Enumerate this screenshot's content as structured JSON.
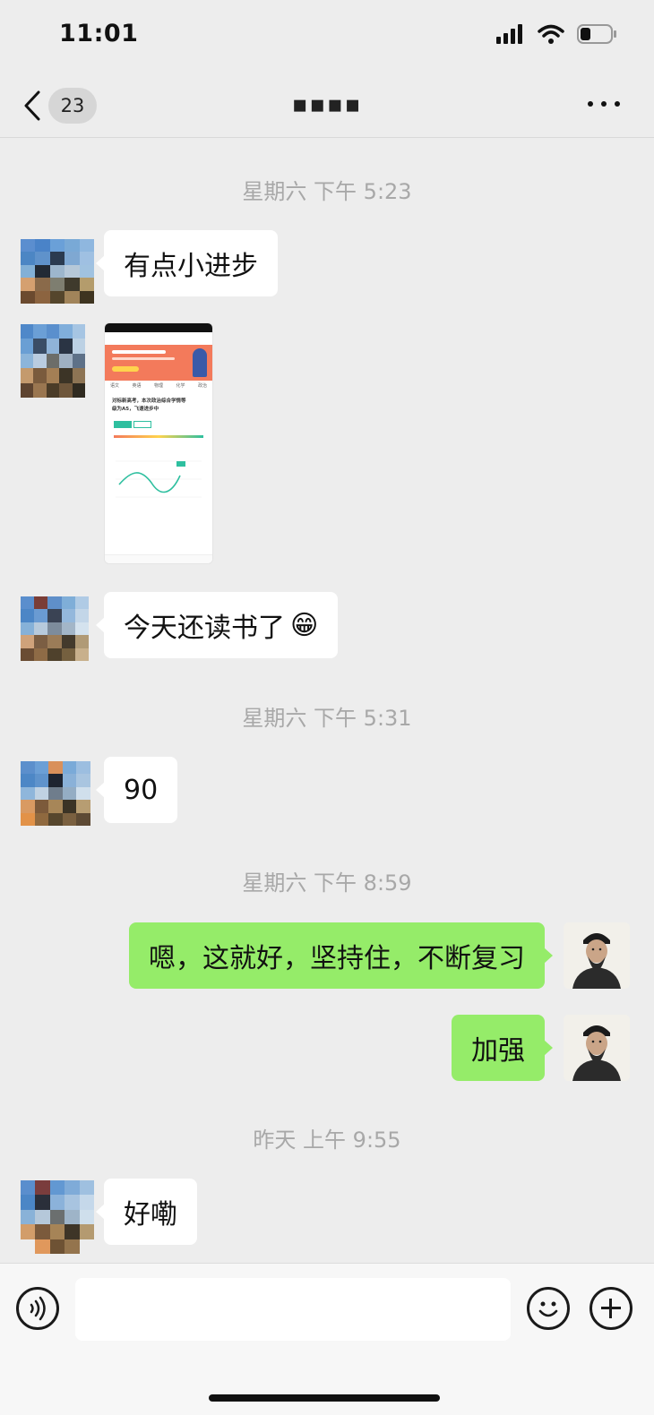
{
  "status_bar": {
    "time": "11:01"
  },
  "nav": {
    "unread_count": "23",
    "title": "▪▪▪▪"
  },
  "messages": [
    {
      "type": "timestamp",
      "text": "星期六 下午 5:23"
    },
    {
      "type": "text",
      "side": "in",
      "text": "有点小进步"
    },
    {
      "type": "image",
      "side": "in",
      "caption_lines": [
        "对标新高考，本次政治综合学情等",
        "级为A5，飞速进步中"
      ]
    },
    {
      "type": "text",
      "side": "in",
      "text": "今天还读书了",
      "emoji": "😁"
    },
    {
      "type": "timestamp",
      "text": "星期六 下午 5:31"
    },
    {
      "type": "text",
      "side": "in",
      "text": "90"
    },
    {
      "type": "timestamp",
      "text": "星期六 下午 8:59"
    },
    {
      "type": "text",
      "side": "out",
      "text": "嗯，这就好，坚持住，不断复习"
    },
    {
      "type": "text",
      "side": "out",
      "text": "加强"
    },
    {
      "type": "timestamp",
      "text": "昨天 上午 9:55"
    },
    {
      "type": "text",
      "side": "in",
      "text": "好嘞"
    }
  ],
  "screenshot_tabs": [
    "语文",
    "英语",
    "物理",
    "化学",
    "政治"
  ],
  "input_bar": {
    "placeholder": ""
  },
  "colors": {
    "background": "#ededed",
    "incoming_bubble": "#ffffff",
    "outgoing_bubble": "#95ec69",
    "timestamp": "#a8a8a8"
  },
  "icons": {
    "back": "chevron-left-icon",
    "more": "ellipsis-icon",
    "voice": "voice-icon",
    "emoji": "smiley-icon",
    "plus": "plus-icon",
    "signal": "signal-icon",
    "wifi": "wifi-icon",
    "battery": "battery-icon"
  }
}
